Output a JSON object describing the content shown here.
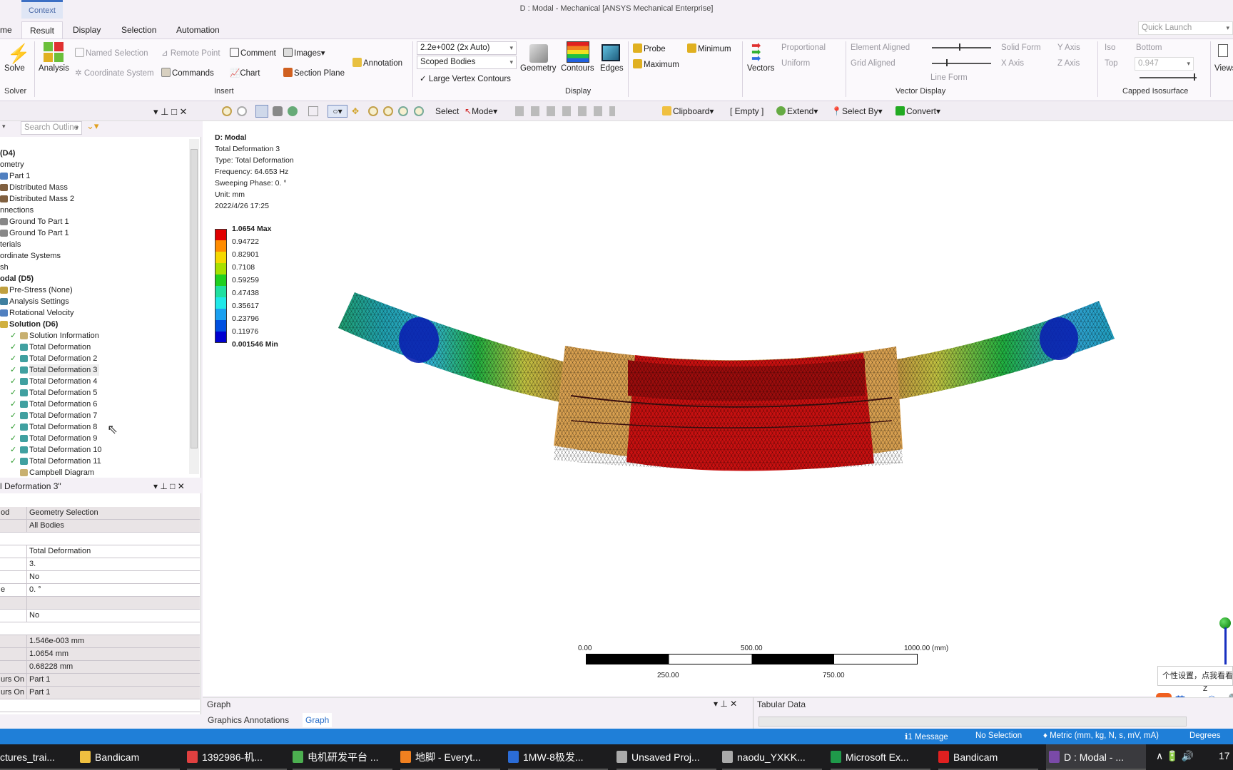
{
  "window": {
    "title": "D : Modal - Mechanical [ANSYS Mechanical Enterprise]",
    "context_tab": "Context",
    "quick_launch_placeholder": "Quick Launch"
  },
  "tabs": [
    "me",
    "Result",
    "Display",
    "Selection",
    "Automation"
  ],
  "active_tab": "Result",
  "ribbon": {
    "solve": "Solve",
    "solver_group": "Solver",
    "analysis": "Analysis",
    "named_selection": "Named Selection",
    "coordinate_system": "Coordinate System",
    "remote_point": "Remote Point",
    "commands": "Commands",
    "comment": "Comment",
    "chart": "Chart",
    "images": "Images",
    "section_plane": "Section Plane",
    "annotation": "Annotation",
    "insert_group": "Insert",
    "scale_select": "2.2e+002 (2x Auto)",
    "scope_select": "Scoped Bodies",
    "large_vertex_contours": "Large Vertex Contours",
    "large_vertex_checked": true,
    "geometry": "Geometry",
    "contours": "Contours",
    "edges": "Edges",
    "display_group": "Display",
    "probe": "Probe",
    "maximum": "Maximum",
    "minimum": "Minimum",
    "vectors": "Vectors",
    "proportional": "Proportional",
    "uniform": "Uniform",
    "element_aligned": "Element Aligned",
    "grid_aligned": "Grid Aligned",
    "line_form": "Line Form",
    "solid_form": "Solid Form",
    "x_axis": "X Axis",
    "y_axis": "Y Axis",
    "z_axis": "Z Axis",
    "vector_display_group": "Vector Display",
    "iso": "Iso",
    "top": "Top",
    "bottom": "Bottom",
    "iso_value": "0.947",
    "capped_isosurface_group": "Capped Isosurface",
    "views": "Views"
  },
  "toolbar": {
    "select": "Select",
    "mode": "Mode",
    "clipboard": "Clipboard",
    "empty": "[ Empty ]",
    "extend": "Extend",
    "select_by": "Select By",
    "convert": "Convert"
  },
  "outline": {
    "search_placeholder": "Search Outline",
    "items": [
      {
        "label": "(D4)",
        "x": 0,
        "bold": true,
        "icon": ""
      },
      {
        "label": "ometry",
        "x": 0,
        "icon": ""
      },
      {
        "label": "Part 1",
        "x": 13,
        "icon": "part"
      },
      {
        "label": "Distributed Mass",
        "x": 13,
        "icon": "mass"
      },
      {
        "label": "Distributed Mass 2",
        "x": 13,
        "icon": "mass"
      },
      {
        "label": "nnections",
        "x": 0,
        "icon": ""
      },
      {
        "label": "Ground To Part 1",
        "x": 13,
        "icon": "joint"
      },
      {
        "label": "Ground To Part 1",
        "x": 13,
        "icon": "joint"
      },
      {
        "label": "terials",
        "x": 0,
        "icon": ""
      },
      {
        "label": "ordinate Systems",
        "x": 0,
        "icon": ""
      },
      {
        "label": "sh",
        "x": 0,
        "icon": ""
      },
      {
        "label": "odal (D5)",
        "x": 0,
        "bold": true,
        "icon": ""
      },
      {
        "label": "Pre-Stress (None)",
        "x": 13,
        "icon": "prestress"
      },
      {
        "label": "Analysis Settings",
        "x": 13,
        "icon": "settings"
      },
      {
        "label": "Rotational Velocity",
        "x": 13,
        "icon": "velocity"
      },
      {
        "label": "Solution (D6)",
        "x": 13,
        "bold": true,
        "icon": "solution"
      },
      {
        "label": "Solution Information",
        "x": 41,
        "icon": "info",
        "check": true
      },
      {
        "label": "Total Deformation",
        "x": 41,
        "icon": "result",
        "check": true
      },
      {
        "label": "Total Deformation 2",
        "x": 41,
        "icon": "result",
        "check": true
      },
      {
        "label": "Total Deformation 3",
        "x": 41,
        "icon": "result",
        "check": true,
        "selected": true
      },
      {
        "label": "Total Deformation 4",
        "x": 41,
        "icon": "result",
        "check": true
      },
      {
        "label": "Total Deformation 5",
        "x": 41,
        "icon": "result",
        "check": true
      },
      {
        "label": "Total Deformation 6",
        "x": 41,
        "icon": "result",
        "check": true
      },
      {
        "label": "Total Deformation 7",
        "x": 41,
        "icon": "result",
        "check": true
      },
      {
        "label": "Total Deformation 8",
        "x": 41,
        "icon": "result",
        "check": true
      },
      {
        "label": "Total Deformation 9",
        "x": 41,
        "icon": "result",
        "check": true
      },
      {
        "label": "Total Deformation 10",
        "x": 41,
        "icon": "result",
        "check": true
      },
      {
        "label": "Total Deformation 11",
        "x": 41,
        "icon": "result",
        "check": true
      },
      {
        "label": "Campbell Diagram",
        "x": 41,
        "icon": "info"
      }
    ]
  },
  "details": {
    "title": "l Deformation 3\"",
    "rows": [
      {
        "label": "od",
        "value": "Geometry Selection",
        "gray": true
      },
      {
        "label": "",
        "value": "All Bodies",
        "gray": true
      },
      {
        "label": "",
        "value": "",
        "section": true
      },
      {
        "label": "",
        "value": "Total Deformation"
      },
      {
        "label": "",
        "value": "3."
      },
      {
        "label": "",
        "value": "No"
      },
      {
        "label": "e",
        "value": "0. °"
      },
      {
        "label": "",
        "value": "",
        "gray": true
      },
      {
        "label": "",
        "value": "No"
      },
      {
        "label": "",
        "value": "",
        "section": true
      },
      {
        "label": "",
        "value": "1.546e-003 mm",
        "gray": true
      },
      {
        "label": "",
        "value": "1.0654 mm",
        "gray": true
      },
      {
        "label": "",
        "value": "0.68228 mm",
        "gray": true
      },
      {
        "label": "urs On",
        "value": "Part 1",
        "gray": true
      },
      {
        "label": "urs On",
        "value": "Part 1",
        "gray": true
      },
      {
        "label": "",
        "value": "",
        "section": true
      }
    ]
  },
  "graphics": {
    "info": [
      "D: Modal",
      "Total Deformation 3",
      "Type: Total Deformation",
      "Frequency: 64.653 Hz",
      "Sweeping Phase: 0. °",
      "Unit: mm",
      "2022/4/26 17:25"
    ],
    "legend": {
      "labels": [
        "1.0654 Max",
        "0.94722",
        "0.82901",
        "0.7108",
        "0.59259",
        "0.47438",
        "0.35617",
        "0.23796",
        "0.11976",
        "0.001546 Min"
      ],
      "colors": [
        "#e00000",
        "#ff8c00",
        "#f5d800",
        "#a8e000",
        "#20d020",
        "#20e0a0",
        "#20e8e8",
        "#1aa0f0",
        "#0050e0",
        "#0000d0"
      ]
    },
    "scale_bar": {
      "top": [
        "0.00",
        "500.00",
        "1000.00 (mm)"
      ],
      "bottom": [
        "250.00",
        "750.00"
      ]
    }
  },
  "bottom_panels": {
    "graph": "Graph",
    "tabular": "Tabular Data",
    "tabs": [
      "Graphics Annotations",
      "Graph"
    ]
  },
  "ime": {
    "tooltip": "个性设置，点我看看",
    "lang": "英",
    "triad_z": "Z"
  },
  "status": {
    "messages": "1 Message",
    "selection": "No Selection",
    "units": "Metric (mm, kg, N, s, mV, mA)",
    "angle": "Degrees"
  },
  "taskbar": [
    {
      "label": "ctures_trai...",
      "color": ""
    },
    {
      "label": "Bandicam",
      "color": "#f0c040"
    },
    {
      "label": "1392986-机...",
      "color": "#e04040"
    },
    {
      "label": "电机研发平台 ...",
      "color": "#4caf50"
    },
    {
      "label": "地脚 - Everyt...",
      "color": "#f08020"
    },
    {
      "label": "1MW-8极发...",
      "color": "#2b6cd6"
    },
    {
      "label": "Unsaved Proj...",
      "color": "#aaaaaa"
    },
    {
      "label": "naodu_YXKK...",
      "color": "#aaaaaa"
    },
    {
      "label": "Microsoft Ex...",
      "color": "#1f9a4a"
    },
    {
      "label": "Bandicam",
      "color": "#e02020"
    },
    {
      "label": "D : Modal - ...",
      "color": "#7a4aa8",
      "active": true
    }
  ],
  "tray": {
    "clock": "17"
  }
}
